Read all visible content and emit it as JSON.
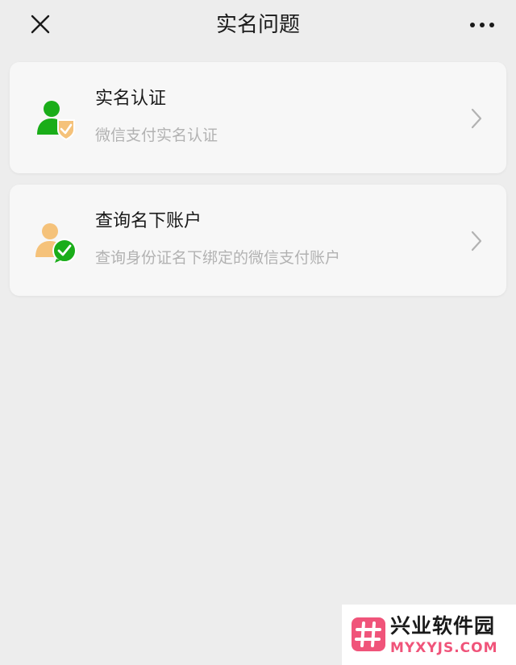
{
  "header": {
    "title": "实名问题",
    "close_icon": "close-icon",
    "more_icon": "more-dots-icon"
  },
  "cards": [
    {
      "title": "实名认证",
      "subtitle": "微信支付实名认证",
      "icon": "user-shield-icon",
      "icon_colors": {
        "person": "#1aad19",
        "badge": "#f5c27a"
      }
    },
    {
      "title": "查询名下账户",
      "subtitle": "查询身份证名下绑定的微信支付账户",
      "icon": "user-wechat-icon",
      "icon_colors": {
        "person": "#f5c27a",
        "badge": "#1aad19"
      }
    }
  ],
  "watermark": {
    "name_cn": "兴业软件园",
    "name_en": "MYXYJS.COM",
    "accent": "#f0547a"
  },
  "colors": {
    "background": "#ededed",
    "card": "#f7f7f7",
    "text": "#1a1a1a",
    "subtext": "#b2b2b2",
    "chevron": "#b2b2b2"
  }
}
